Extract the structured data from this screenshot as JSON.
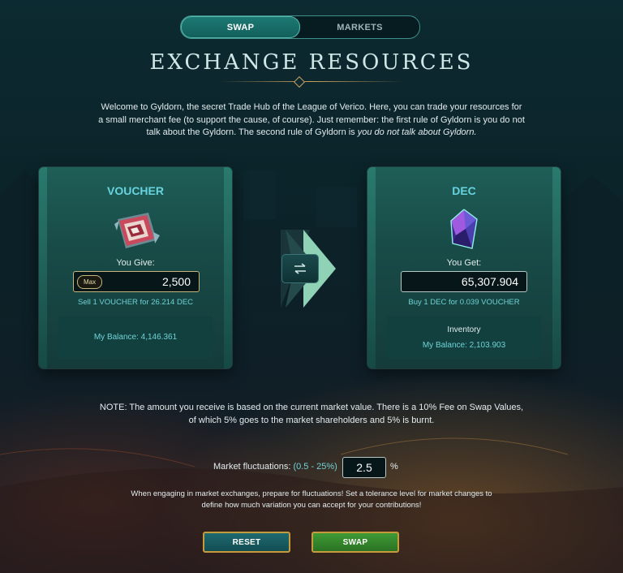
{
  "tabs": [
    {
      "label": "SWAP",
      "active": true
    },
    {
      "label": "MARKETS",
      "active": false
    }
  ],
  "title": "EXCHANGE RESOURCES",
  "intro": {
    "text": "Welcome to Gyldorn, the secret Trade Hub of the League of Verico. Here, you can trade your resources for a small merchant fee (to support the cause, of course). Just remember: the first rule of Gyldorn is you do not talk about the Gyldorn. The second rule of Gyldorn is ",
    "italic": "you do not talk about Gyldorn."
  },
  "give": {
    "resource": "VOUCHER",
    "label": "You Give:",
    "max_label": "Max",
    "value": "2,500",
    "rate": "Sell 1 VOUCHER for 26.214 DEC",
    "balance": "My Balance: 4,146.361",
    "icon": "voucher-icon"
  },
  "get": {
    "resource": "DEC",
    "label": "You Get:",
    "value": "65,307.904",
    "rate": "Buy 1 DEC for 0.039 VOUCHER",
    "inventory_label": "Inventory",
    "balance": "My Balance: 2,103.903",
    "icon": "dec-crystal-icon"
  },
  "note": "NOTE: The amount you receive is based on the current market value. There is a 10% Fee on Swap Values, of which 5% goes to the market shareholders and 5% is burnt.",
  "fluctuation": {
    "label": "Market fluctuations:",
    "range": "(0.5 - 25%)",
    "value": "2.5",
    "unit": "%"
  },
  "warning": "When engaging in market exchanges, prepare for fluctuations! Set a tolerance level for market changes to define how much variation you can accept for your contributions!",
  "buttons": {
    "reset": "RESET",
    "swap": "SWAP"
  },
  "colors": {
    "accent_cyan": "#67d3df",
    "gold_border": "#c79a3c",
    "swap_green": "#3f9a35",
    "card_teal": "#1f5e57"
  }
}
